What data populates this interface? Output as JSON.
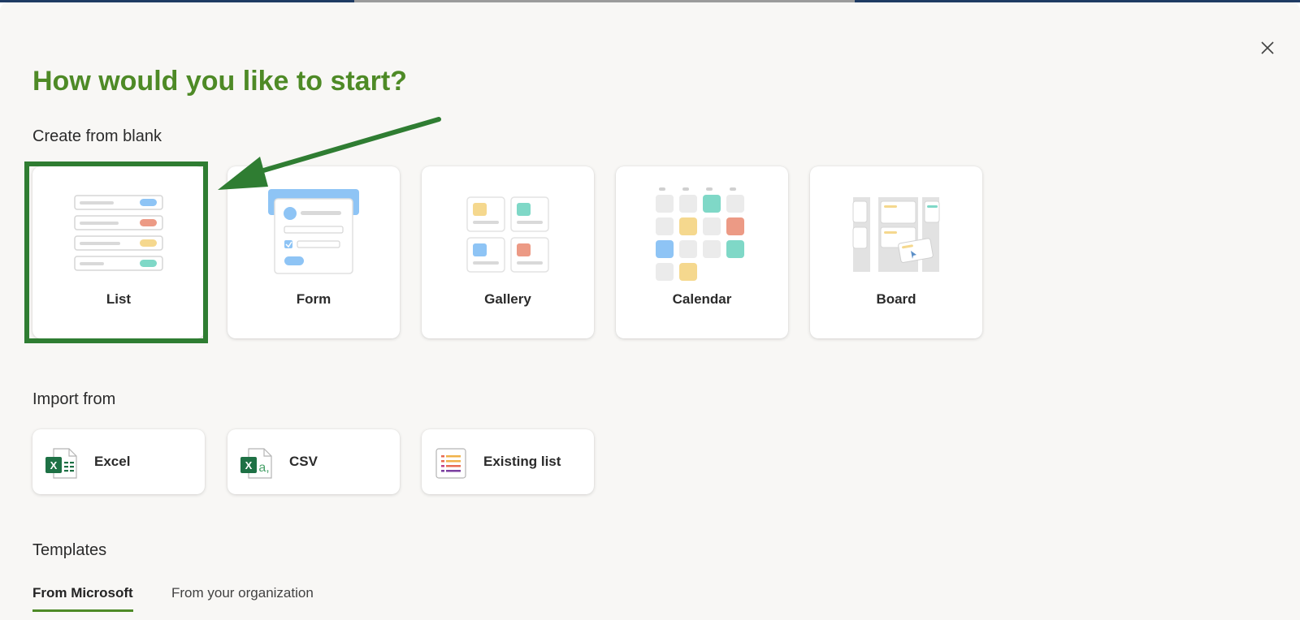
{
  "dialog": {
    "title": "How would you like to start?",
    "close_icon": "close-icon"
  },
  "create_from_blank": {
    "label": "Create from blank",
    "cards": [
      {
        "label": "List",
        "icon": "list-illustration"
      },
      {
        "label": "Form",
        "icon": "form-illustration"
      },
      {
        "label": "Gallery",
        "icon": "gallery-illustration"
      },
      {
        "label": "Calendar",
        "icon": "calendar-illustration"
      },
      {
        "label": "Board",
        "icon": "board-illustration"
      }
    ]
  },
  "import_from": {
    "label": "Import from",
    "items": [
      {
        "label": "Excel",
        "icon": "excel-icon"
      },
      {
        "label": "CSV",
        "icon": "csv-icon"
      },
      {
        "label": "Existing list",
        "icon": "existing-list-icon"
      }
    ]
  },
  "templates": {
    "label": "Templates",
    "tabs": [
      {
        "label": "From Microsoft",
        "active": true
      },
      {
        "label": "From your organization",
        "active": false
      }
    ]
  },
  "colors": {
    "accent_green": "#4e8a26",
    "highlight_green": "#2f7d32",
    "excel_green": "#1e7145",
    "blue": "#8ec4f5",
    "red": "#ec9a85",
    "yellow": "#f5d88e",
    "teal": "#7fd8c7"
  }
}
